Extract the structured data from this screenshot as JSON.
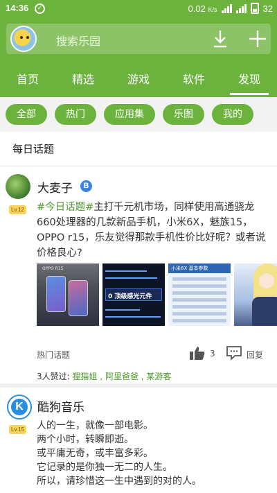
{
  "status_bar": {
    "time": "14:36",
    "speed": "0.02",
    "speed_unit": "K/s",
    "battery": "32"
  },
  "header": {
    "search_placeholder": "搜索乐园",
    "tabs": [
      {
        "label": "首页"
      },
      {
        "label": "精选"
      },
      {
        "label": "游戏"
      },
      {
        "label": "软件"
      },
      {
        "label": "发现",
        "active": true
      }
    ]
  },
  "chips": [
    "全部",
    "热门",
    "应用集",
    "乐图",
    "我的"
  ],
  "section_title": "每日话题",
  "post1": {
    "author": "大麦子",
    "verified_badge": "B",
    "level": "Lv.12",
    "tag": "#今日话题#",
    "text": "主打千元机市场，同样使用高通骁龙660处理器的几款新品手机，小米6X，魅族15，OPPO r15，乐友觉得那款手机性价比好呢？或者说价格良心?",
    "thumbnails": [
      {
        "caption": "OPPO R15"
      },
      {
        "caption": "0 顶级感光元件"
      },
      {
        "caption": "小米6X 基本参数"
      },
      {
        "caption": ""
      }
    ],
    "topic_label": "热门话题",
    "likes": "3",
    "reply_label": "回复",
    "likers_prefix": "3人赞过:",
    "likers_names": "狸猫姐 , 阿里爸爸 , 某游客"
  },
  "post2": {
    "author": "酷狗音乐",
    "avatar_letter": "K",
    "level": "Lv.15",
    "lines": [
      "人的一生，就像一部电影。",
      "两个小时，转瞬即逝。",
      "或平庸无奇，或丰富多彩。",
      "它记录的是你独一无二的人生。",
      "所以，请珍惜这一生中遇到的对的人。"
    ]
  },
  "colors": {
    "brand_green": "#6bb33c",
    "tag_green": "#4c9a2a",
    "verified_blue": "#3a84e6",
    "level_yellow": "#f7d55a"
  },
  "icons": [
    "search-avatar",
    "download-icon",
    "plus-icon",
    "like-icon",
    "reply-icon",
    "signal-icon",
    "battery-icon"
  ]
}
